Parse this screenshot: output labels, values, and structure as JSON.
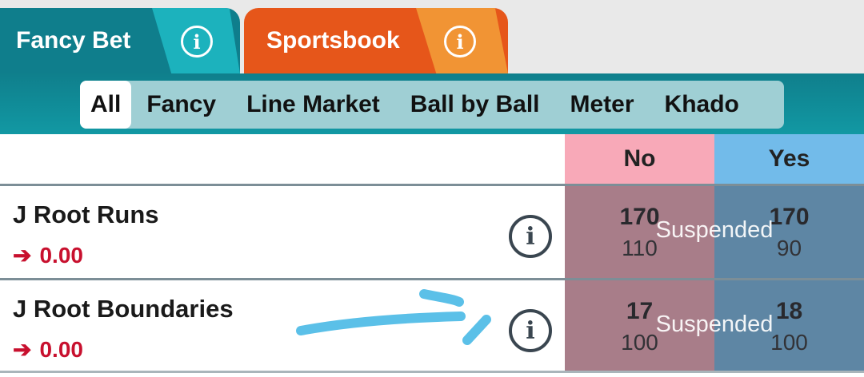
{
  "tabs": [
    {
      "label": "Fancy Bet",
      "color": "#0f7e8c"
    },
    {
      "label": "Sportsbook",
      "color": "#e6561a"
    }
  ],
  "filters": [
    "All",
    "Fancy",
    "Line Market",
    "Ball by Ball",
    "Meter",
    "Khado"
  ],
  "active_filter": "All",
  "table": {
    "header_no": "No",
    "header_yes": "Yes",
    "rows": [
      {
        "name": "J Root Runs",
        "pl": "0.00",
        "no_odds": "170",
        "no_size": "110",
        "yes_odds": "170",
        "yes_size": "90",
        "status": "Suspended"
      },
      {
        "name": "J Root Boundaries",
        "pl": "0.00",
        "no_odds": "17",
        "no_size": "100",
        "yes_odds": "18",
        "yes_size": "100",
        "status": "Suspended"
      }
    ]
  },
  "colors": {
    "no": "#f8a9b8",
    "yes": "#72bbea",
    "loss": "#c8102e"
  }
}
